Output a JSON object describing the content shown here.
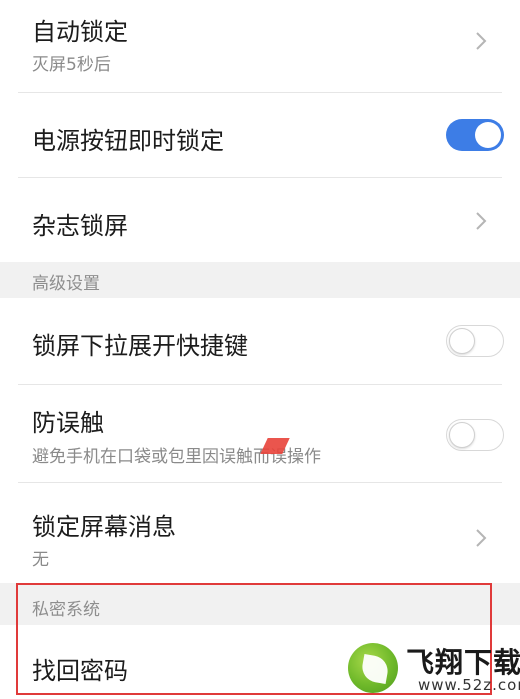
{
  "settings": {
    "auto_lock": {
      "title": "自动锁定",
      "subtitle": "灭屏5秒后"
    },
    "power_lock": {
      "title": "电源按钮即时锁定",
      "enabled": true
    },
    "magazine": {
      "title": "杂志锁屏"
    },
    "advanced_header": "高级设置",
    "pull_shortcut": {
      "title": "锁屏下拉展开快捷键",
      "enabled": false
    },
    "anti_touch": {
      "title": "防误触",
      "subtitle": "避免手机在口袋或包里因误触而误操作",
      "enabled": false
    },
    "lock_messages": {
      "title": "锁定屏幕消息",
      "subtitle": "无"
    },
    "private_header": "私密系统",
    "recover_password": {
      "title": "找回密码"
    }
  },
  "watermark": {
    "title": "飞翔下载",
    "url": "www.52z.com"
  },
  "colors": {
    "toggle_on": "#3d7de6",
    "highlight_border": "#e03a3a",
    "section_bg": "#f1f1f1"
  }
}
